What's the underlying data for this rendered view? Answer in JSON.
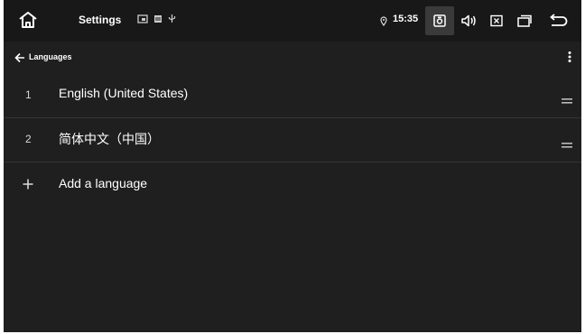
{
  "status_bar": {
    "title": "Settings",
    "time": "15:35",
    "icons": [
      "home-icon",
      "notification-cast-icon",
      "notification-media-icon",
      "usb-icon",
      "location-icon",
      "screenshot-icon",
      "volume-icon",
      "close-box-icon",
      "recent-apps-icon",
      "back-icon"
    ]
  },
  "action_bar": {
    "title": "Languages",
    "back_icon": "arrow-left-icon",
    "more_icon": "more-vertical-icon"
  },
  "languages": [
    {
      "index": "1",
      "label": "English (United States)"
    },
    {
      "index": "2",
      "label": "简体中文（中国）"
    }
  ],
  "add_language": {
    "label": "Add a language",
    "icon": "plus-icon"
  },
  "colors": {
    "background": "#1f1f1f",
    "status_bar": "#181818",
    "divider": "#343434",
    "text": "#ffffff"
  }
}
